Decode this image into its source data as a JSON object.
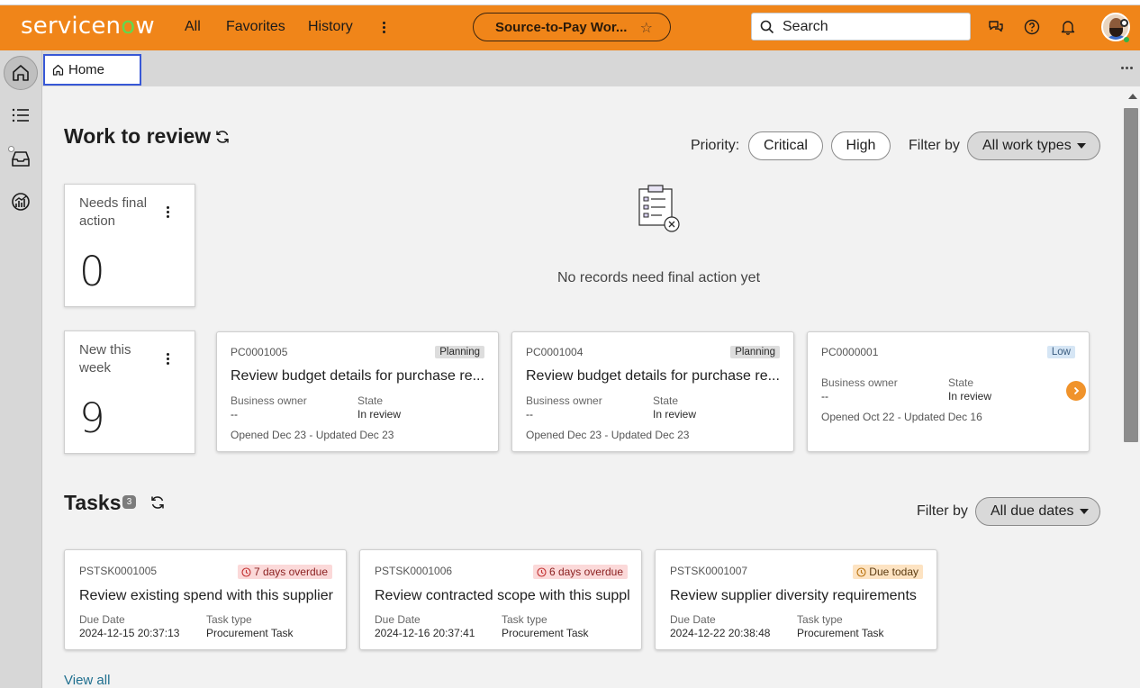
{
  "header": {
    "logo_text_a": "servicen",
    "logo_text_o": "o",
    "logo_text_b": "w",
    "nav": [
      "All",
      "Favorites",
      "History"
    ],
    "app_title": "Source-to-Pay Wor...",
    "search_placeholder": "Search",
    "colors": {
      "header_bg": "#f08519",
      "logo_accent": "#62d84e"
    }
  },
  "tabs": {
    "home_label": "Home"
  },
  "work_review": {
    "title": "Work to review",
    "priority_label": "Priority:",
    "priority_chips": [
      "Critical",
      "High"
    ],
    "filter_label": "Filter by",
    "filter_value": "All work types",
    "stats": [
      {
        "label": "Needs final action",
        "value": "0"
      },
      {
        "label": "New this week",
        "value": "9"
      }
    ],
    "empty_message": "No records need final action yet",
    "cards": [
      {
        "id": "PC0001005",
        "badge": "Planning",
        "title": "Review budget details for purchase re...",
        "owner_label": "Business owner",
        "owner_value": "--",
        "state_label": "State",
        "state_value": "In review",
        "opened": "Opened Dec 23 - Updated Dec 23"
      },
      {
        "id": "PC0001004",
        "badge": "Planning",
        "title": "Review budget details for purchase re...",
        "owner_label": "Business owner",
        "owner_value": "--",
        "state_label": "State",
        "state_value": "In review",
        "opened": "Opened Dec 23 - Updated Dec 23"
      },
      {
        "id": "PC0000001",
        "badge": "Low",
        "title": "",
        "owner_label": "Business owner",
        "owner_value": "--",
        "state_label": "State",
        "state_value": "In review",
        "opened": "Opened Oct 22 - Updated Dec 16"
      }
    ]
  },
  "tasks": {
    "title": "Tasks",
    "count": "3",
    "filter_label": "Filter by",
    "filter_value": "All due dates",
    "cards": [
      {
        "id": "PSTSK0001005",
        "due_badge": "7 days overdue",
        "title": "Review existing spend with this supplier",
        "due_label": "Due Date",
        "due_value": "2024-12-15 20:37:13",
        "type_label": "Task type",
        "type_value": "Procurement Task"
      },
      {
        "id": "PSTSK0001006",
        "due_badge": "6 days overdue",
        "title": "Review contracted scope with this suppl",
        "due_label": "Due Date",
        "due_value": "2024-12-16 20:37:41",
        "type_label": "Task type",
        "type_value": "Procurement Task"
      },
      {
        "id": "PSTSK0001007",
        "due_badge": "Due today",
        "title": "Review supplier diversity requirements",
        "due_label": "Due Date",
        "due_value": "2024-12-22 20:38:48",
        "type_label": "Task type",
        "type_value": "Procurement Task"
      }
    ],
    "view_all": "View all"
  },
  "icons": [
    "home-icon",
    "list-icon",
    "inbox-icon",
    "analytics-icon",
    "search-icon",
    "chat-icon",
    "help-icon",
    "bell-icon",
    "star-icon",
    "refresh-icon",
    "clipboard-empty-icon",
    "chevron-right-icon",
    "clock-icon"
  ]
}
